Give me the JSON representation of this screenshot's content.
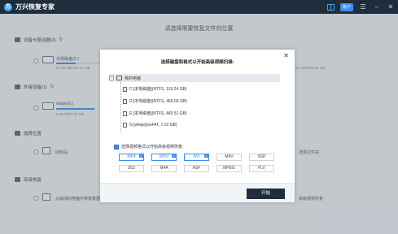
{
  "app": {
    "title": "万兴恢复专家",
    "logo": "万",
    "member_badge": "账户"
  },
  "main": {
    "title": "请选择需要恢复文件的位置"
  },
  "sections": {
    "devices": "设备与驱动器(3)",
    "external": "外接设备(1)",
    "select_location": "选择位置",
    "advanced": "高级恢复"
  },
  "drives": [
    {
      "name": "本地磁盘(C:)",
      "size": "51.33 GB/119.24 GB",
      "used_fraction": 0.43
    },
    {
      "name": "wiiqie(G:)",
      "size": "6.98 GB/7.22 GB",
      "used_fraction": 0.97
    }
  ],
  "right_drive_size": "465.21 GB/465.51 GB",
  "bg_items": {
    "recycle": "回收站",
    "select_folder": "选择文件夹",
    "advanced_left": "从崩溃的电脑中恢复数据",
    "advanced_right": "高级视频恢复"
  },
  "dialog": {
    "title": "选择磁盘和格式以开始高级视频扫描:",
    "tree_root": "我的电脑",
    "tree_items": [
      "C:[本地磁盘](NTFS, 119.24 GB)",
      "D:[本地磁盘](NTFS, 466.00 GB)",
      "E:[本地磁盘](NTFS, 465.51 GB)",
      "G:[wiiqie](exFAT, 7.22 GB)"
    ],
    "format_label": "选择视频格式以开始高级视频恢复:",
    "formats": [
      "MP4",
      "MOV",
      "AVI",
      "M4V",
      "3GP",
      "3G2",
      "M4A",
      "ASF",
      "MPEG",
      "FLV"
    ],
    "selected_formats": [
      "MP4",
      "MOV",
      "AVI"
    ],
    "start_button": "开始"
  },
  "colors": {
    "titlebar": "#1f2d3d",
    "accent": "#3d8ef0"
  }
}
